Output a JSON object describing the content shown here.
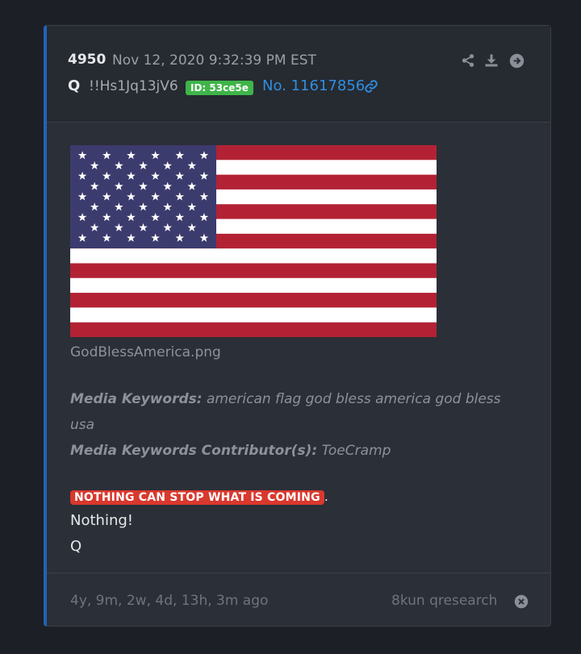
{
  "post": {
    "number": "4950",
    "date": "Nov 12, 2020 9:32:39 PM EST",
    "author": "Q",
    "tripcode": "!!Hs1Jq13jV6",
    "id_badge": "ID: 53ce5e",
    "post_ref": "No. 11617856"
  },
  "header_icons": [
    "share-icon",
    "download-icon",
    "arrow-right-circle-icon"
  ],
  "media": {
    "image_name": "flag-image",
    "filename": "GodBlessAmerica.png",
    "keywords_label": "Media Keywords:",
    "keywords": "american flag god bless america god bless usa",
    "contributors_label": "Media Keywords Contributor(s):",
    "contributors": "ToeCramp"
  },
  "message": {
    "highlight": "NOTHING CAN STOP WHAT IS COMING",
    "punct": ".",
    "line1": "Nothing!",
    "line2": "Q"
  },
  "footer": {
    "age": "4y, 9m, 2w, 4d, 13h, 3m ago",
    "source": "8kun qresearch"
  },
  "colors": {
    "accent_blue": "#2f8ee0",
    "badge_green": "#3fb549",
    "highlight_red": "#d9382e",
    "card_bg": "#2b2f37"
  }
}
